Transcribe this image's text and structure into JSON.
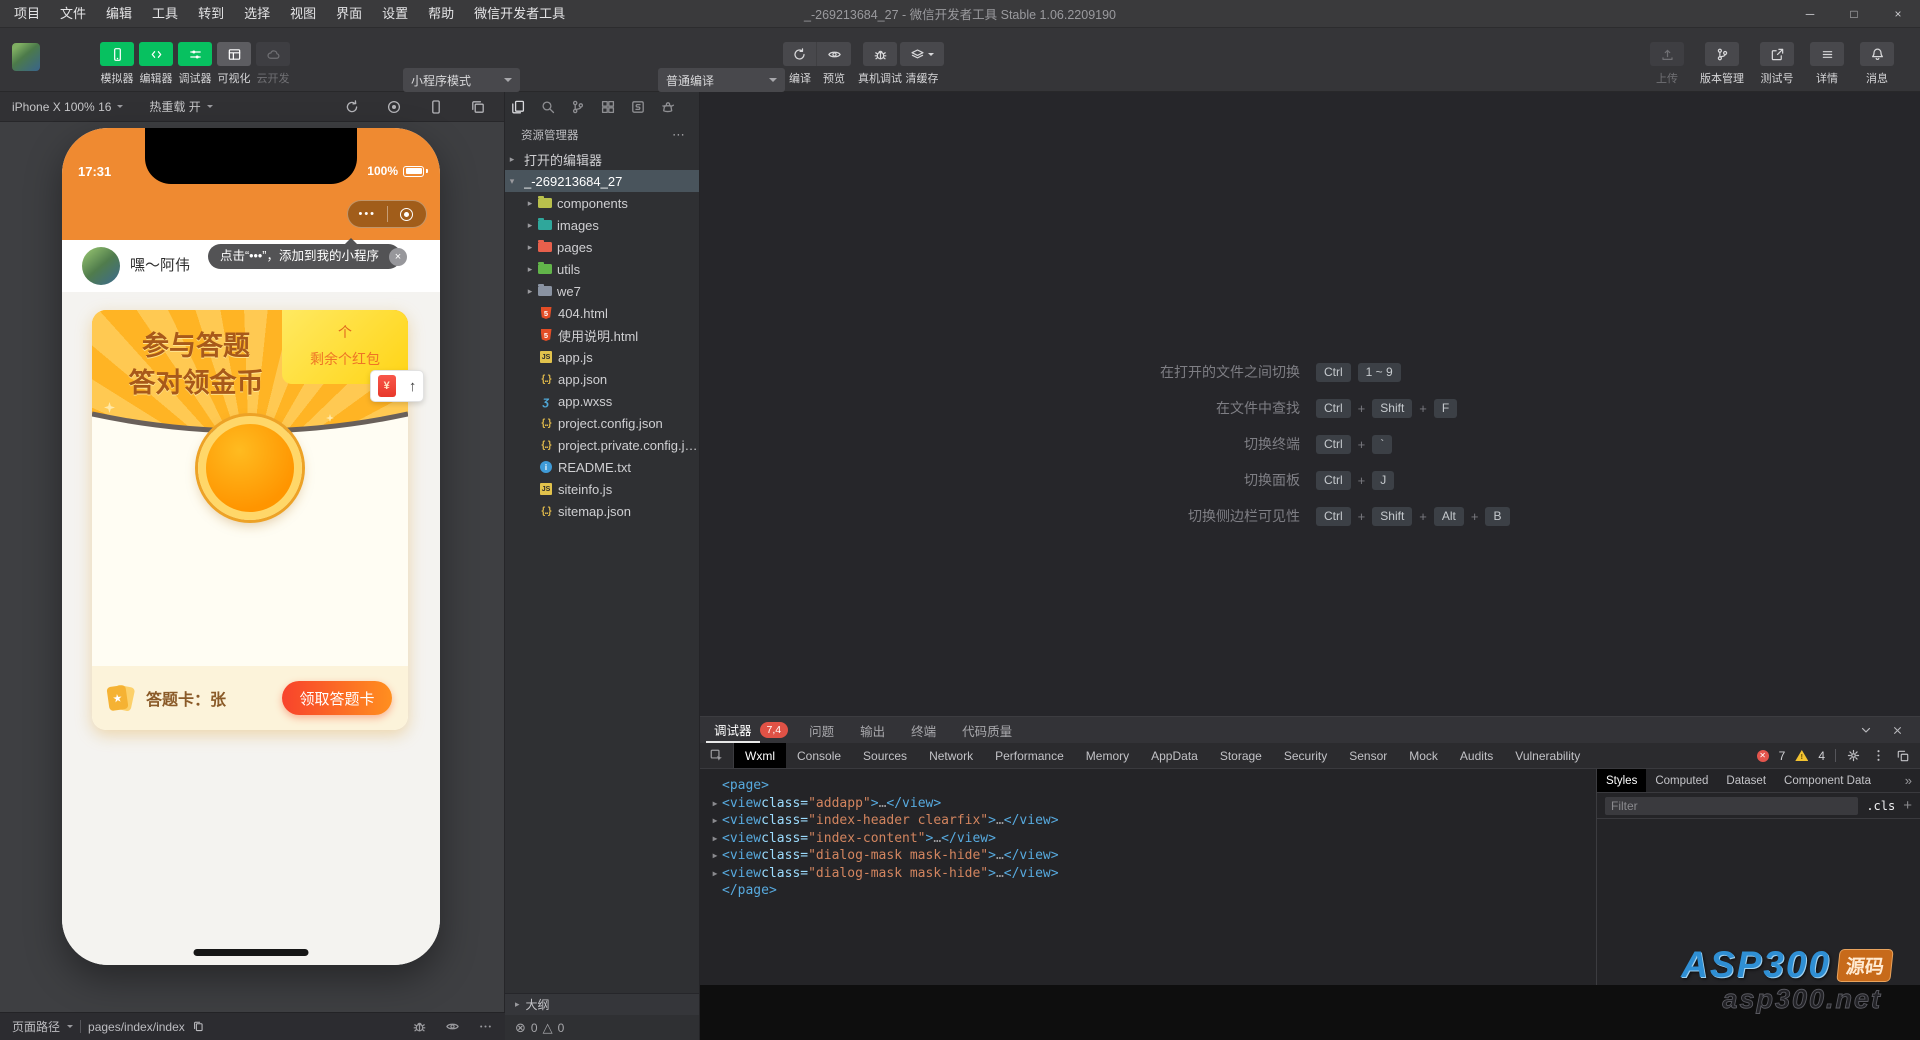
{
  "colors": {
    "wechat_green": "#07c160",
    "phone_orange": "#ef8a31",
    "badge_red": "#e05246",
    "warning_yellow": "#f2c230",
    "error_red": "#e3554d",
    "watermark_blue": "#2f8fd4",
    "watermark_orange": "#c76a1a"
  },
  "titlebar": {
    "menus": [
      "项目",
      "文件",
      "编辑",
      "工具",
      "转到",
      "选择",
      "视图",
      "界面",
      "设置",
      "帮助",
      "微信开发者工具"
    ],
    "title": "_-269213684_27 - 微信开发者工具 Stable 1.06.2209190"
  },
  "toolbar": {
    "view_buttons": [
      {
        "label": "模拟器",
        "icon": "phone",
        "state": "on"
      },
      {
        "label": "编辑器",
        "icon": "code",
        "state": "on"
      },
      {
        "label": "调试器",
        "icon": "sliders",
        "state": "on"
      },
      {
        "label": "可视化",
        "icon": "layout",
        "state": "neutral"
      },
      {
        "label": "云开发",
        "icon": "cloud",
        "state": "disabled"
      }
    ],
    "mode_select": "小程序模式",
    "compile_select": "普通编译",
    "compile_label": "编译",
    "preview_label": "预览",
    "remote_debug_label": "真机调试",
    "clear_cache_label": "清缓存",
    "right_buttons": [
      {
        "label": "上传",
        "icon": "upload",
        "state": "disabled"
      },
      {
        "label": "版本管理",
        "icon": "branch",
        "state": "plain"
      },
      {
        "label": "测试号",
        "icon": "external",
        "state": "plain"
      },
      {
        "label": "详情",
        "icon": "list",
        "state": "plain"
      },
      {
        "label": "消息",
        "icon": "bell",
        "state": "plain"
      }
    ]
  },
  "simulator": {
    "device_label": "iPhone X 100% 16",
    "hot_reload_label": "热重载 开",
    "toolbar_icons": [
      "rotate",
      "record",
      "device",
      "windows"
    ],
    "statusbar": {
      "path_label": "页面路径",
      "path": "pages/index/index"
    },
    "phone": {
      "time": "17:31",
      "battery": "100%",
      "capsule_dots": "•••",
      "nickname": "嘿～阿伟",
      "tooltip": "点击“•••”，添加到我的小程序",
      "tooltip_close": "×",
      "envelope_symbol": "¥",
      "arrow_up": "↑",
      "card": {
        "title_line1": "参与答题",
        "title_line2": "答对领金币",
        "corner_top": "个",
        "corner_bottom": "剩余个红包",
        "footer_label": "答题卡：张",
        "footer_button": "领取答题卡",
        "footer_icon_star": "★"
      }
    }
  },
  "sidebar": {
    "activity_icons": [
      "files",
      "search",
      "source-control",
      "extensions",
      "snippets",
      "tea"
    ],
    "explorer_title": "资源管理器",
    "explorer_more": "⋯",
    "tree": [
      {
        "kind": "section",
        "caret": "▸",
        "label": "打开的编辑器"
      },
      {
        "kind": "project",
        "caret": "▾",
        "label": "_-269213684_27",
        "selected": true
      },
      {
        "kind": "folder",
        "caret": "▸",
        "label": "components",
        "color": "#b9c04c"
      },
      {
        "kind": "folder",
        "caret": "▸",
        "label": "images",
        "color": "#2fa79b"
      },
      {
        "kind": "folder",
        "caret": "▸",
        "label": "pages",
        "color": "#e8604c"
      },
      {
        "kind": "folder",
        "caret": "▸",
        "label": "utils",
        "color": "#62b54a"
      },
      {
        "kind": "folder",
        "caret": "▸",
        "label": "we7",
        "color": "#8a93a2"
      },
      {
        "kind": "file",
        "icon": "html",
        "label": "404.html"
      },
      {
        "kind": "file",
        "icon": "html",
        "label": "使用说明.html"
      },
      {
        "kind": "file",
        "icon": "js",
        "label": "app.js"
      },
      {
        "kind": "file",
        "icon": "json",
        "label": "app.json"
      },
      {
        "kind": "file",
        "icon": "wxss",
        "label": "app.wxss"
      },
      {
        "kind": "file",
        "icon": "json",
        "label": "project.config.json"
      },
      {
        "kind": "file",
        "icon": "json",
        "label": "project.private.config.js…"
      },
      {
        "kind": "file",
        "icon": "info",
        "label": "README.txt"
      },
      {
        "kind": "file",
        "icon": "js",
        "label": "siteinfo.js"
      },
      {
        "kind": "file",
        "icon": "json",
        "label": "sitemap.json"
      }
    ],
    "outline_label": "大纲",
    "problems": {
      "error_symbol": "⊗",
      "error_count": "0",
      "warning_symbol": "△",
      "warning_count": "0"
    }
  },
  "editor": {
    "shortcuts": [
      {
        "label": "在打开的文件之间切换",
        "keys": [
          "Ctrl",
          "1 ~ 9"
        ]
      },
      {
        "label": "在文件中查找",
        "keys": [
          "Ctrl",
          "+",
          "Shift",
          "+",
          "F"
        ]
      },
      {
        "label": "切换终端",
        "keys": [
          "Ctrl",
          "+",
          "`"
        ]
      },
      {
        "label": "切换面板",
        "keys": [
          "Ctrl",
          "+",
          "J"
        ]
      },
      {
        "label": "切换侧边栏可见性",
        "keys": [
          "Ctrl",
          "+",
          "Shift",
          "+",
          "Alt",
          "+",
          "B"
        ]
      }
    ]
  },
  "debugger": {
    "panel_tabs": [
      {
        "label": "调试器",
        "active": true,
        "badge": "7,4"
      },
      {
        "label": "问题"
      },
      {
        "label": "输出"
      },
      {
        "label": "终端"
      },
      {
        "label": "代码质量"
      }
    ],
    "devtools_tabs": [
      "Wxml",
      "Console",
      "Sources",
      "Network",
      "Performance",
      "Memory",
      "AppData",
      "Storage",
      "Security",
      "Sensor",
      "Mock",
      "Audits",
      "Vulnerability"
    ],
    "active_devtools_tab": "Wxml",
    "error_count": "7",
    "warning_count": "4",
    "code_lines": [
      {
        "expand": false,
        "segs": [
          {
            "c": "tag",
            "t": "<page>"
          }
        ]
      },
      {
        "expand": true,
        "segs": [
          {
            "c": "tag",
            "t": "<view"
          },
          {
            "c": "attr",
            "t": " class="
          },
          {
            "c": "str",
            "t": "\"addapp\""
          },
          {
            "c": "tag",
            "t": ">"
          },
          {
            "c": "dim",
            "t": "…"
          },
          {
            "c": "tag",
            "t": "</view>"
          }
        ]
      },
      {
        "expand": true,
        "segs": [
          {
            "c": "tag",
            "t": "<view"
          },
          {
            "c": "attr",
            "t": " class="
          },
          {
            "c": "str",
            "t": "\"index-header clearfix\""
          },
          {
            "c": "tag",
            "t": ">"
          },
          {
            "c": "dim",
            "t": "…"
          },
          {
            "c": "tag",
            "t": "</view>"
          }
        ]
      },
      {
        "expand": true,
        "segs": [
          {
            "c": "tag",
            "t": "<view"
          },
          {
            "c": "attr",
            "t": " class="
          },
          {
            "c": "str",
            "t": "\"index-content\""
          },
          {
            "c": "tag",
            "t": ">"
          },
          {
            "c": "dim",
            "t": "…"
          },
          {
            "c": "tag",
            "t": "</view>"
          }
        ]
      },
      {
        "expand": true,
        "segs": [
          {
            "c": "tag",
            "t": "<view"
          },
          {
            "c": "attr",
            "t": " class="
          },
          {
            "c": "str",
            "t": "\"dialog-mask mask-hide\""
          },
          {
            "c": "tag",
            "t": ">"
          },
          {
            "c": "dim",
            "t": "…"
          },
          {
            "c": "tag",
            "t": "</view>"
          }
        ]
      },
      {
        "expand": true,
        "segs": [
          {
            "c": "tag",
            "t": "<view"
          },
          {
            "c": "attr",
            "t": " class="
          },
          {
            "c": "str",
            "t": "\"dialog-mask mask-hide\""
          },
          {
            "c": "tag",
            "t": ">"
          },
          {
            "c": "dim",
            "t": "…"
          },
          {
            "c": "tag",
            "t": "</view>"
          }
        ]
      },
      {
        "expand": false,
        "segs": [
          {
            "c": "tag",
            "t": "</page>"
          }
        ]
      }
    ],
    "styles_tabs": [
      "Styles",
      "Computed",
      "Dataset",
      "Component Data"
    ],
    "styles_more": "»",
    "filter_placeholder": "Filter",
    "cls_label": ".cls",
    "add_label": "+"
  },
  "watermark": {
    "brand": "ASP300",
    "badge": "源码",
    "domain": "asp300.net"
  }
}
